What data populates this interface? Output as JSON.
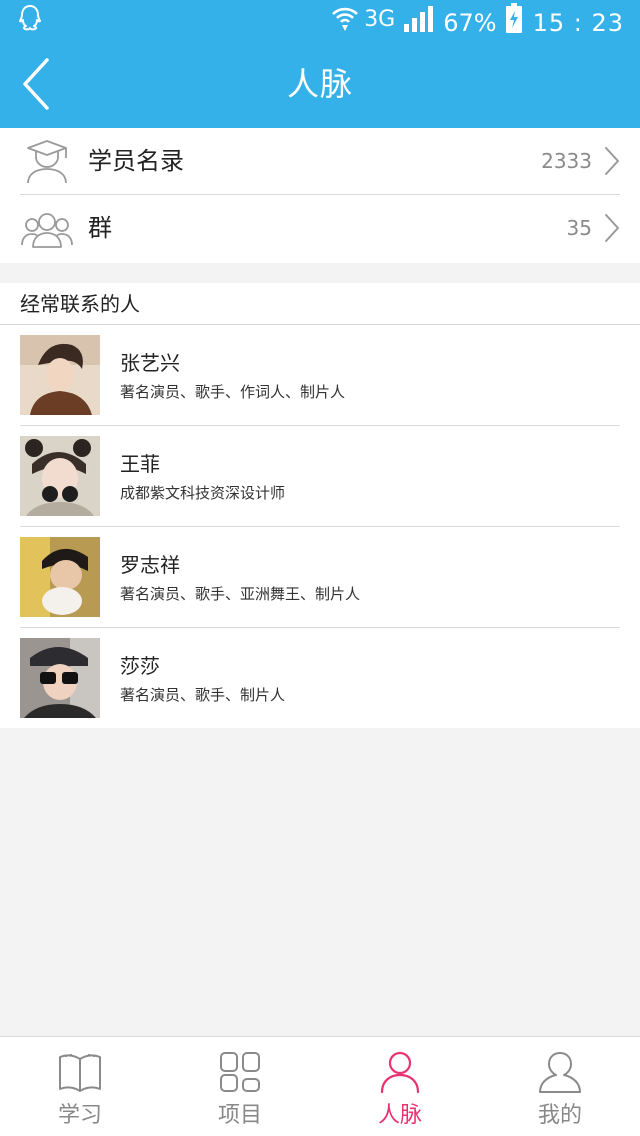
{
  "status_bar": {
    "network": "3G",
    "battery": "67%",
    "time": "15 : 23"
  },
  "nav": {
    "title": "人脉"
  },
  "entries": [
    {
      "label": "学员名录",
      "count": "2333",
      "icon": "graduate-user-icon"
    },
    {
      "label": "群",
      "count": "35",
      "icon": "group-icon"
    }
  ],
  "frequent": {
    "title": "经常联系的人",
    "contacts": [
      {
        "name": "张艺兴",
        "desc": "著名演员、歌手、作词人、制片人"
      },
      {
        "name": "王菲",
        "desc": "成都紫文科技资深设计师"
      },
      {
        "name": "罗志祥",
        "desc": "著名演员、歌手、亚洲舞王、制片人"
      },
      {
        "name": "莎莎",
        "desc": "著名演员、歌手、制片人"
      }
    ]
  },
  "tabs": [
    {
      "label": "学习",
      "icon": "book-icon",
      "active": false
    },
    {
      "label": "项目",
      "icon": "grid-icon",
      "active": false
    },
    {
      "label": "人脉",
      "icon": "person-icon",
      "active": true
    },
    {
      "label": "我的",
      "icon": "profile-icon",
      "active": false
    }
  ],
  "colors": {
    "header": "#35b1ea",
    "accent": "#e8336f",
    "background": "#f3f3f3"
  }
}
